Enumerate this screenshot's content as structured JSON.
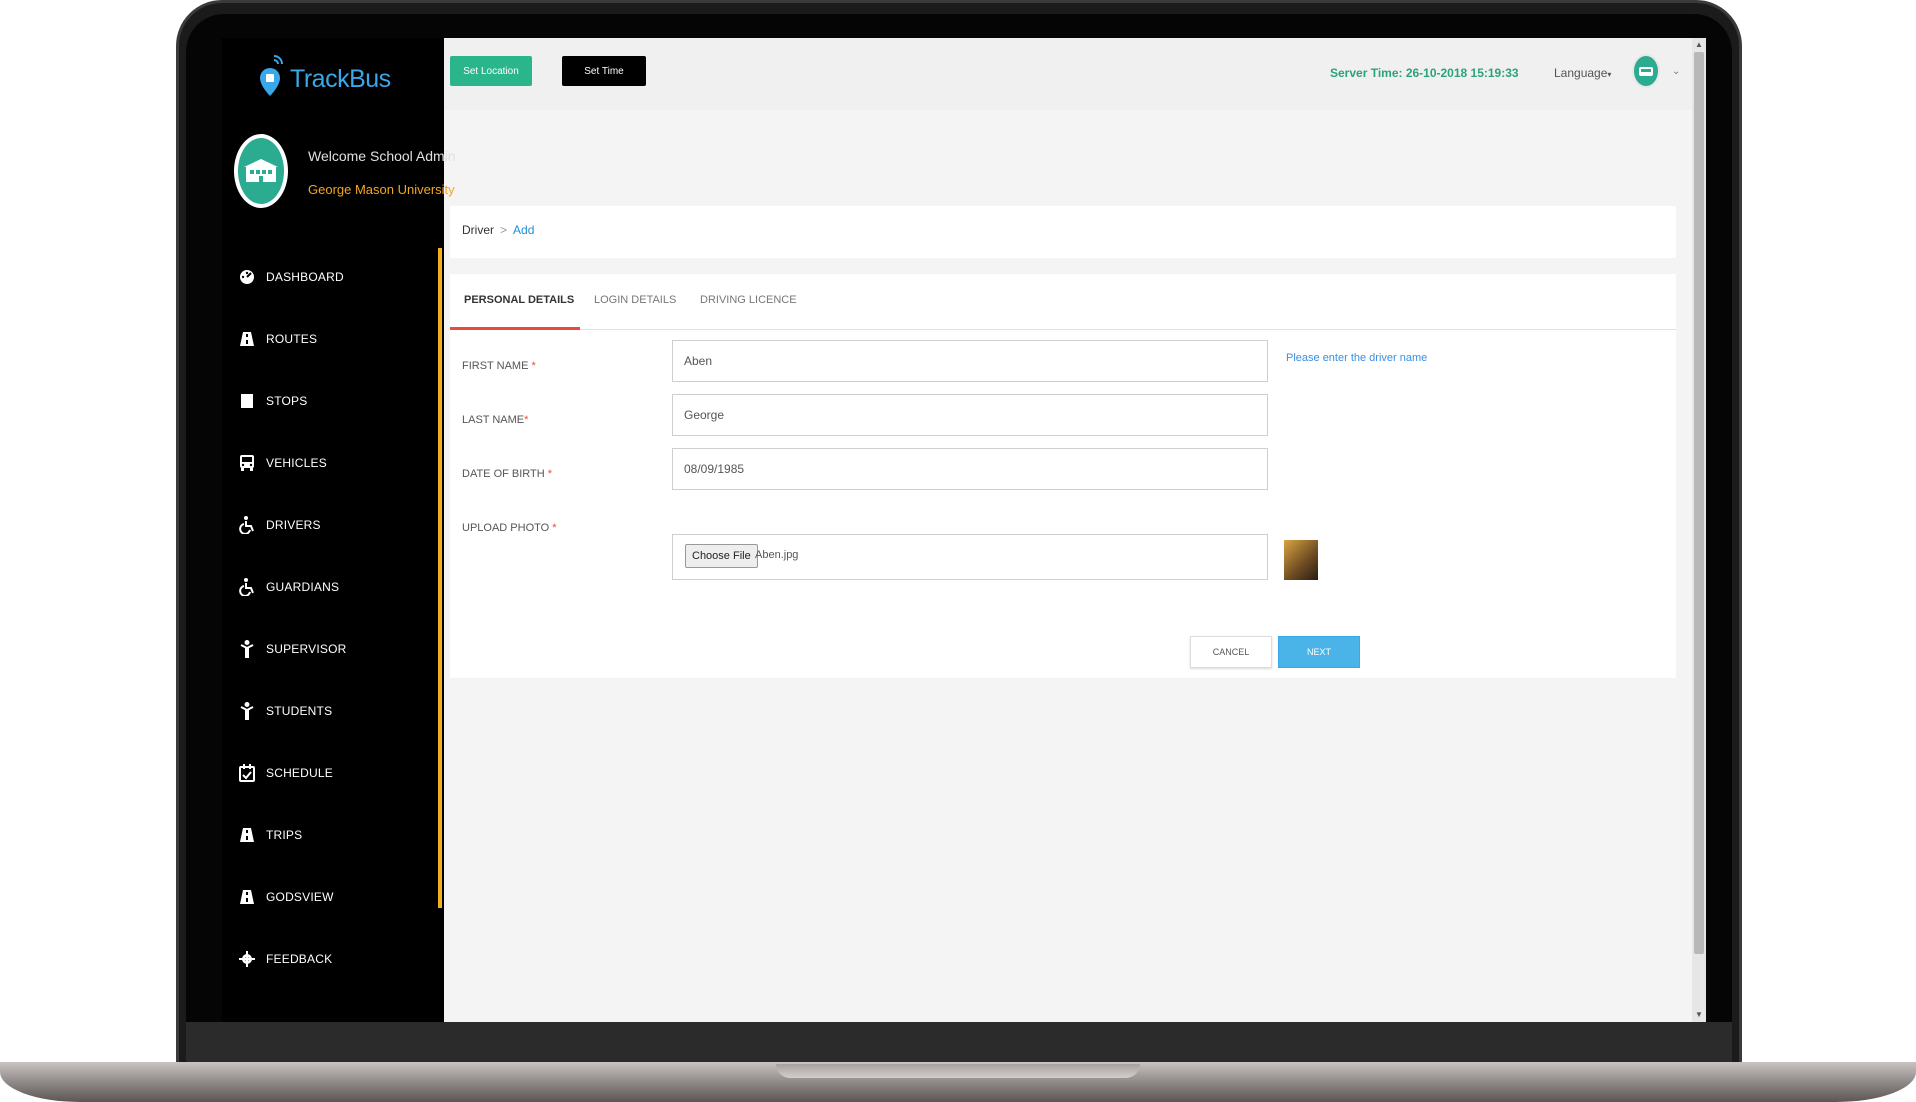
{
  "app": {
    "logo_text": "TrackBus"
  },
  "sidebar": {
    "welcome": "Welcome School Admin",
    "university": "George Mason University",
    "items": [
      {
        "label": "DASHBOARD",
        "icon": "dashboard-icon"
      },
      {
        "label": "ROUTES",
        "icon": "road-icon"
      },
      {
        "label": "STOPS",
        "icon": "stop-icon"
      },
      {
        "label": "VEHICLES",
        "icon": "bus-icon"
      },
      {
        "label": "DRIVERS",
        "icon": "wheelchair-icon"
      },
      {
        "label": "GUARDIANS",
        "icon": "wheelchair-icon"
      },
      {
        "label": "SUPERVISOR",
        "icon": "person-icon"
      },
      {
        "label": "STUDENTS",
        "icon": "person-icon"
      },
      {
        "label": "SCHEDULE",
        "icon": "calendar-check-icon"
      },
      {
        "label": "TRIPS",
        "icon": "road-icon"
      },
      {
        "label": "GODSVIEW",
        "icon": "road-icon"
      },
      {
        "label": "FEEDBACK",
        "icon": "gear-icon"
      }
    ]
  },
  "topbar": {
    "set_location": "Set Location",
    "set_time": "Set Time",
    "server_time": "Server Time: 26-10-2018 15:19:33",
    "language": "Language"
  },
  "breadcrumb": {
    "parent": "Driver",
    "separator": ">",
    "current": "Add"
  },
  "tabs": [
    {
      "label": "PERSONAL DETAILS",
      "active": true
    },
    {
      "label": "LOGIN DETAILS",
      "active": false
    },
    {
      "label": "DRIVING LICENCE",
      "active": false
    }
  ],
  "form": {
    "first_name": {
      "label": "FIRST NAME",
      "required": "*",
      "value": "Aben"
    },
    "last_name": {
      "label": "LAST NAME",
      "required": "*",
      "value": "George"
    },
    "dob": {
      "label": "DATE OF BIRTH",
      "required": "*",
      "value": "08/09/1985"
    },
    "photo": {
      "label": "UPLOAD PHOTO",
      "required": "*",
      "button": "Choose File",
      "file_name": "Aben.jpg"
    },
    "hint": "Please enter the driver name",
    "cancel": "CANCEL",
    "next": "NEXT"
  },
  "colors": {
    "accent_green": "#2bb58b",
    "accent_blue": "#4ab4e8",
    "sidebar_accent": "#f2b01e",
    "tab_underline": "#e84b3a"
  }
}
